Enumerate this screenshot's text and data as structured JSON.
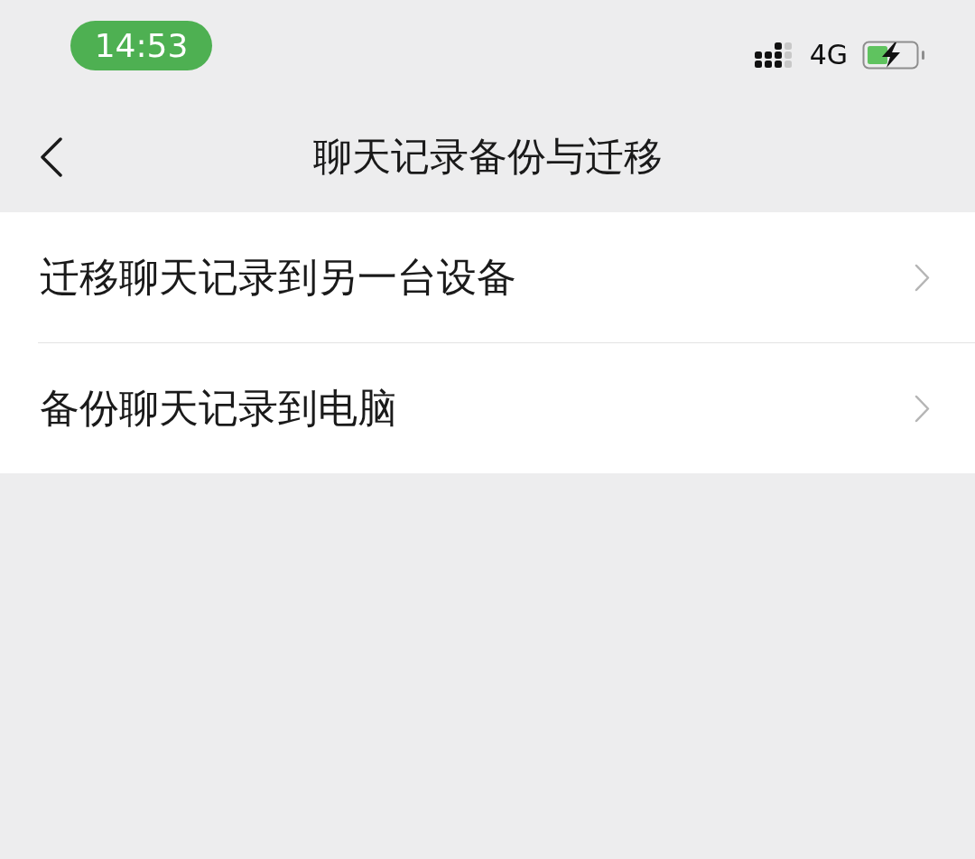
{
  "status_bar": {
    "time": "14:53",
    "network": "4G"
  },
  "nav_bar": {
    "title": "聊天记录备份与迁移"
  },
  "menu_items": [
    {
      "label": "迁移聊天记录到另一台设备"
    },
    {
      "label": "备份聊天记录到电脑"
    }
  ]
}
